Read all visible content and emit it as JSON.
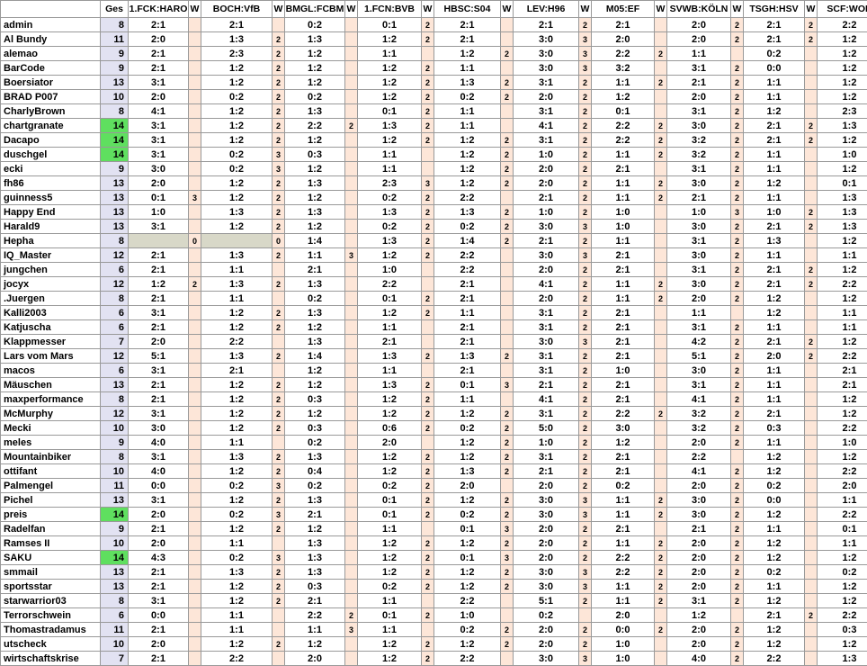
{
  "headers": [
    "",
    "Ges",
    "1.FCK:HARO",
    "W",
    "BOCH:VfB",
    "W",
    "BMGL:FCBM",
    "W",
    "1.FCN:BVB",
    "W",
    "HBSC:S04",
    "W",
    "LEV:H96",
    "W",
    "M05:EF",
    "W",
    "SVWB:KÖLN",
    "W",
    "TSGH:HSV",
    "W",
    "SCF:WOB",
    "W"
  ],
  "rows": [
    {
      "name": "admin",
      "ges": "8",
      "cells": [
        "2:1",
        "",
        "2:1",
        "",
        "0:2",
        "",
        "0:1",
        "2",
        "2:1",
        "",
        "2:1",
        "2",
        "2:1",
        "",
        "2:0",
        "2",
        "2:1",
        "2",
        "2:2",
        ""
      ]
    },
    {
      "name": "Al Bundy",
      "ges": "11",
      "cells": [
        "2:0",
        "",
        "1:3",
        "2",
        "1:3",
        "",
        "1:2",
        "2",
        "2:1",
        "",
        "3:0",
        "3",
        "2:0",
        "",
        "2:0",
        "2",
        "2:1",
        "2",
        "1:2",
        ""
      ]
    },
    {
      "name": "alemao",
      "ges": "9",
      "cells": [
        "2:1",
        "",
        "2:3",
        "2",
        "1:2",
        "",
        "1:1",
        "",
        "1:2",
        "2",
        "3:0",
        "3",
        "2:2",
        "2",
        "1:1",
        "",
        "0:2",
        "",
        "1:2",
        ""
      ]
    },
    {
      "name": "BarCode",
      "ges": "9",
      "cells": [
        "2:1",
        "",
        "1:2",
        "2",
        "1:2",
        "",
        "1:2",
        "2",
        "1:1",
        "",
        "3:0",
        "3",
        "3:2",
        "",
        "3:1",
        "2",
        "0:0",
        "",
        "1:2",
        ""
      ]
    },
    {
      "name": "Boersiator",
      "ges": "13",
      "cells": [
        "3:1",
        "",
        "1:2",
        "2",
        "1:2",
        "",
        "1:2",
        "2",
        "1:3",
        "2",
        "3:1",
        "2",
        "1:1",
        "2",
        "2:1",
        "2",
        "1:1",
        "",
        "1:2",
        ""
      ]
    },
    {
      "name": "BRAD P007",
      "ges": "10",
      "cells": [
        "2:0",
        "",
        "0:2",
        "2",
        "0:2",
        "",
        "1:2",
        "2",
        "0:2",
        "2",
        "2:0",
        "2",
        "1:2",
        "",
        "2:0",
        "2",
        "1:1",
        "",
        "1:2",
        ""
      ]
    },
    {
      "name": "CharlyBrown",
      "ges": "8",
      "cells": [
        "4:1",
        "",
        "1:2",
        "2",
        "1:3",
        "",
        "0:1",
        "2",
        "1:1",
        "",
        "3:1",
        "2",
        "0:1",
        "",
        "3:1",
        "2",
        "1:2",
        "",
        "2:3",
        ""
      ]
    },
    {
      "name": "chartgranate",
      "ges": "14",
      "cells": [
        "3:1",
        "",
        "1:2",
        "2",
        "2:2",
        "2",
        "1:3",
        "2",
        "1:1",
        "",
        "4:1",
        "2",
        "2:2",
        "2",
        "3:0",
        "2",
        "2:1",
        "2",
        "1:3",
        ""
      ]
    },
    {
      "name": "Dacapo",
      "ges": "14",
      "cells": [
        "3:1",
        "",
        "1:2",
        "2",
        "1:2",
        "",
        "1:2",
        "2",
        "1:2",
        "2",
        "3:1",
        "2",
        "2:2",
        "2",
        "3:2",
        "2",
        "2:1",
        "2",
        "1:2",
        ""
      ]
    },
    {
      "name": "duschgel",
      "ges": "14",
      "cells": [
        "3:1",
        "",
        "0:2",
        "3",
        "0:3",
        "",
        "1:1",
        "",
        "1:2",
        "2",
        "1:0",
        "2",
        "1:1",
        "2",
        "3:2",
        "2",
        "1:1",
        "",
        "1:0",
        "3"
      ]
    },
    {
      "name": "ecki",
      "ges": "9",
      "cells": [
        "3:0",
        "",
        "0:2",
        "3",
        "1:2",
        "",
        "1:1",
        "",
        "1:2",
        "2",
        "2:0",
        "2",
        "2:1",
        "",
        "3:1",
        "2",
        "1:1",
        "",
        "1:2",
        ""
      ]
    },
    {
      "name": "fh86",
      "ges": "13",
      "cells": [
        "2:0",
        "",
        "1:2",
        "2",
        "1:3",
        "",
        "2:3",
        "3",
        "1:2",
        "2",
        "2:0",
        "2",
        "1:1",
        "2",
        "3:0",
        "2",
        "1:2",
        "",
        "0:1",
        ""
      ]
    },
    {
      "name": "guinness5",
      "ges": "13",
      "cells": [
        "0:1",
        "3",
        "1:2",
        "2",
        "1:2",
        "",
        "0:2",
        "2",
        "2:2",
        "",
        "2:1",
        "2",
        "1:1",
        "2",
        "2:1",
        "2",
        "1:1",
        "",
        "1:3",
        ""
      ]
    },
    {
      "name": "Happy End",
      "ges": "13",
      "cells": [
        "1:0",
        "",
        "1:3",
        "2",
        "1:3",
        "",
        "1:3",
        "2",
        "1:3",
        "2",
        "1:0",
        "2",
        "1:0",
        "",
        "1:0",
        "3",
        "1:0",
        "2",
        "1:3",
        ""
      ]
    },
    {
      "name": "Harald9",
      "ges": "13",
      "cells": [
        "3:1",
        "",
        "1:2",
        "2",
        "1:2",
        "",
        "0:2",
        "2",
        "0:2",
        "2",
        "3:0",
        "3",
        "1:0",
        "",
        "3:0",
        "2",
        "2:1",
        "2",
        "1:3",
        ""
      ]
    },
    {
      "name": "Hepha",
      "ges": "8",
      "cells": [
        "",
        "0",
        "",
        "0",
        "1:4",
        "",
        "1:3",
        "2",
        "1:4",
        "2",
        "2:1",
        "2",
        "1:1",
        "",
        "3:1",
        "2",
        "1:3",
        "",
        "1:2",
        ""
      ]
    },
    {
      "name": "IQ_Master",
      "ges": "12",
      "cells": [
        "2:1",
        "",
        "1:3",
        "2",
        "1:1",
        "3",
        "1:2",
        "2",
        "2:2",
        "",
        "3:0",
        "3",
        "2:1",
        "",
        "3:0",
        "2",
        "1:1",
        "",
        "1:1",
        ""
      ]
    },
    {
      "name": "jungchen",
      "ges": "6",
      "cells": [
        "2:1",
        "",
        "1:1",
        "",
        "2:1",
        "",
        "1:0",
        "",
        "2:2",
        "",
        "2:0",
        "2",
        "2:1",
        "",
        "3:1",
        "2",
        "2:1",
        "2",
        "1:2",
        ""
      ]
    },
    {
      "name": "jocyx",
      "ges": "12",
      "cells": [
        "1:2",
        "2",
        "1:3",
        "2",
        "1:3",
        "",
        "2:2",
        "",
        "2:1",
        "",
        "4:1",
        "2",
        "1:1",
        "2",
        "3:0",
        "2",
        "2:1",
        "2",
        "2:2",
        ""
      ]
    },
    {
      "name": ".Juergen",
      "ges": "8",
      "cells": [
        "2:1",
        "",
        "1:1",
        "",
        "0:2",
        "",
        "0:1",
        "2",
        "2:1",
        "",
        "2:0",
        "2",
        "1:1",
        "2",
        "2:0",
        "2",
        "1:2",
        "",
        "1:2",
        ""
      ]
    },
    {
      "name": "Kalli2003",
      "ges": "6",
      "cells": [
        "3:1",
        "",
        "1:2",
        "2",
        "1:3",
        "",
        "1:2",
        "2",
        "1:1",
        "",
        "3:1",
        "2",
        "2:1",
        "",
        "1:1",
        "",
        "1:2",
        "",
        "1:1",
        ""
      ]
    },
    {
      "name": "Katjuscha",
      "ges": "6",
      "cells": [
        "2:1",
        "",
        "1:2",
        "2",
        "1:2",
        "",
        "1:1",
        "",
        "2:1",
        "",
        "3:1",
        "2",
        "2:1",
        "",
        "3:1",
        "2",
        "1:1",
        "",
        "1:1",
        ""
      ]
    },
    {
      "name": "Klappmesser",
      "ges": "7",
      "cells": [
        "2:0",
        "",
        "2:2",
        "",
        "1:3",
        "",
        "2:1",
        "",
        "2:1",
        "",
        "3:0",
        "3",
        "2:1",
        "",
        "4:2",
        "2",
        "2:1",
        "2",
        "1:2",
        ""
      ]
    },
    {
      "name": "Lars vom Mars",
      "ges": "12",
      "cells": [
        "5:1",
        "",
        "1:3",
        "2",
        "1:4",
        "",
        "1:3",
        "2",
        "1:3",
        "2",
        "3:1",
        "2",
        "2:1",
        "",
        "5:1",
        "2",
        "2:0",
        "2",
        "2:2",
        ""
      ]
    },
    {
      "name": "macos",
      "ges": "6",
      "cells": [
        "3:1",
        "",
        "2:1",
        "",
        "1:2",
        "",
        "1:1",
        "",
        "2:1",
        "",
        "3:1",
        "2",
        "1:0",
        "",
        "3:0",
        "2",
        "1:1",
        "",
        "2:1",
        "2"
      ]
    },
    {
      "name": "Mäuschen",
      "ges": "13",
      "cells": [
        "2:1",
        "",
        "1:2",
        "2",
        "1:2",
        "",
        "1:3",
        "2",
        "0:1",
        "3",
        "2:1",
        "2",
        "2:1",
        "",
        "3:1",
        "2",
        "1:1",
        "",
        "2:1",
        "2"
      ]
    },
    {
      "name": "maxperformance",
      "ges": "8",
      "cells": [
        "2:1",
        "",
        "1:2",
        "2",
        "0:3",
        "",
        "1:2",
        "2",
        "1:1",
        "",
        "4:1",
        "2",
        "2:1",
        "",
        "4:1",
        "2",
        "1:1",
        "",
        "1:2",
        ""
      ]
    },
    {
      "name": "McMurphy",
      "ges": "12",
      "cells": [
        "3:1",
        "",
        "1:2",
        "2",
        "1:2",
        "",
        "1:2",
        "2",
        "1:2",
        "2",
        "3:1",
        "2",
        "2:2",
        "2",
        "3:2",
        "2",
        "2:1",
        "",
        "1:2",
        ""
      ]
    },
    {
      "name": "Mecki",
      "ges": "10",
      "cells": [
        "3:0",
        "",
        "1:2",
        "2",
        "0:3",
        "",
        "0:6",
        "2",
        "0:2",
        "2",
        "5:0",
        "2",
        "3:0",
        "",
        "3:2",
        "2",
        "0:3",
        "",
        "2:2",
        ""
      ]
    },
    {
      "name": "meles",
      "ges": "9",
      "cells": [
        "4:0",
        "",
        "1:1",
        "",
        "0:2",
        "",
        "2:0",
        "",
        "1:2",
        "2",
        "1:0",
        "2",
        "1:2",
        "",
        "2:0",
        "2",
        "1:1",
        "",
        "1:0",
        "3"
      ]
    },
    {
      "name": "Mountainbiker",
      "ges": "8",
      "cells": [
        "3:1",
        "",
        "1:3",
        "2",
        "1:3",
        "",
        "1:2",
        "2",
        "1:2",
        "2",
        "3:1",
        "2",
        "2:1",
        "",
        "2:2",
        "",
        "1:2",
        "",
        "1:2",
        ""
      ]
    },
    {
      "name": "ottifant",
      "ges": "10",
      "cells": [
        "4:0",
        "",
        "1:2",
        "2",
        "0:4",
        "",
        "1:2",
        "2",
        "1:3",
        "2",
        "2:1",
        "2",
        "2:1",
        "",
        "4:1",
        "2",
        "1:2",
        "",
        "2:2",
        ""
      ]
    },
    {
      "name": "Palmengel",
      "ges": "11",
      "cells": [
        "0:0",
        "",
        "0:2",
        "3",
        "0:2",
        "",
        "0:2",
        "2",
        "2:0",
        "",
        "2:0",
        "2",
        "0:2",
        "",
        "2:0",
        "2",
        "0:2",
        "",
        "2:0",
        "2"
      ]
    },
    {
      "name": "Pichel",
      "ges": "13",
      "cells": [
        "3:1",
        "",
        "1:2",
        "2",
        "1:3",
        "",
        "0:1",
        "2",
        "1:2",
        "2",
        "3:0",
        "3",
        "1:1",
        "2",
        "3:0",
        "2",
        "0:0",
        "",
        "1:1",
        ""
      ]
    },
    {
      "name": "preis",
      "ges": "14",
      "cells": [
        "2:0",
        "",
        "0:2",
        "3",
        "2:1",
        "",
        "0:1",
        "2",
        "0:2",
        "2",
        "3:0",
        "3",
        "1:1",
        "2",
        "3:0",
        "2",
        "1:2",
        "",
        "2:2",
        ""
      ]
    },
    {
      "name": "Radelfan",
      "ges": "9",
      "cells": [
        "2:1",
        "",
        "1:2",
        "2",
        "1:2",
        "",
        "1:1",
        "",
        "0:1",
        "3",
        "2:0",
        "2",
        "2:1",
        "",
        "2:1",
        "2",
        "1:1",
        "",
        "0:1",
        ""
      ]
    },
    {
      "name": "Ramses II",
      "ges": "10",
      "cells": [
        "2:0",
        "",
        "1:1",
        "",
        "1:3",
        "",
        "1:2",
        "2",
        "1:2",
        "2",
        "2:0",
        "2",
        "1:1",
        "2",
        "2:0",
        "2",
        "1:2",
        "",
        "1:1",
        ""
      ]
    },
    {
      "name": "SAKU",
      "ges": "14",
      "cells": [
        "4:3",
        "",
        "0:2",
        "3",
        "1:3",
        "",
        "1:2",
        "2",
        "0:1",
        "3",
        "2:0",
        "2",
        "2:2",
        "2",
        "2:0",
        "2",
        "1:2",
        "",
        "1:2",
        ""
      ]
    },
    {
      "name": "smmail",
      "ges": "13",
      "cells": [
        "2:1",
        "",
        "1:3",
        "2",
        "1:3",
        "",
        "1:2",
        "2",
        "1:2",
        "2",
        "3:0",
        "3",
        "2:2",
        "2",
        "2:0",
        "2",
        "0:2",
        "",
        "0:2",
        ""
      ]
    },
    {
      "name": "sportsstar",
      "ges": "13",
      "cells": [
        "2:1",
        "",
        "1:2",
        "2",
        "0:3",
        "",
        "0:2",
        "2",
        "1:2",
        "2",
        "3:0",
        "3",
        "1:1",
        "2",
        "2:0",
        "2",
        "1:1",
        "",
        "1:2",
        ""
      ]
    },
    {
      "name": "starwarrior03",
      "ges": "8",
      "cells": [
        "3:1",
        "",
        "1:2",
        "2",
        "2:1",
        "",
        "1:1",
        "",
        "2:2",
        "",
        "5:1",
        "2",
        "1:1",
        "2",
        "3:1",
        "2",
        "1:2",
        "",
        "1:2",
        ""
      ]
    },
    {
      "name": "Terrorschwein",
      "ges": "6",
      "cells": [
        "0:0",
        "",
        "1:1",
        "",
        "2:2",
        "2",
        "0:1",
        "2",
        "1:0",
        "",
        "0:2",
        "",
        "2:0",
        "",
        "1:2",
        "",
        "2:1",
        "2",
        "2:2",
        ""
      ]
    },
    {
      "name": "Thomastradamus",
      "ges": "11",
      "cells": [
        "2:1",
        "",
        "1:1",
        "",
        "1:1",
        "3",
        "1:1",
        "",
        "0:2",
        "2",
        "2:0",
        "2",
        "0:0",
        "2",
        "2:0",
        "2",
        "1:2",
        "",
        "0:3",
        ""
      ]
    },
    {
      "name": "utscheck",
      "ges": "10",
      "cells": [
        "2:0",
        "",
        "1:2",
        "2",
        "1:2",
        "",
        "1:2",
        "2",
        "1:2",
        "2",
        "2:0",
        "2",
        "1:0",
        "",
        "2:0",
        "2",
        "1:2",
        "",
        "1:2",
        ""
      ]
    },
    {
      "name": "wirtschaftskrise",
      "ges": "7",
      "cells": [
        "2:1",
        "",
        "2:2",
        "",
        "2:0",
        "",
        "1:2",
        "2",
        "2:2",
        "",
        "3:0",
        "3",
        "1:0",
        "",
        "4:0",
        "2",
        "2:2",
        "",
        "1:3",
        ""
      ]
    }
  ],
  "highlight": {
    "ges_max": "14",
    "color": "#5fdf5f"
  }
}
